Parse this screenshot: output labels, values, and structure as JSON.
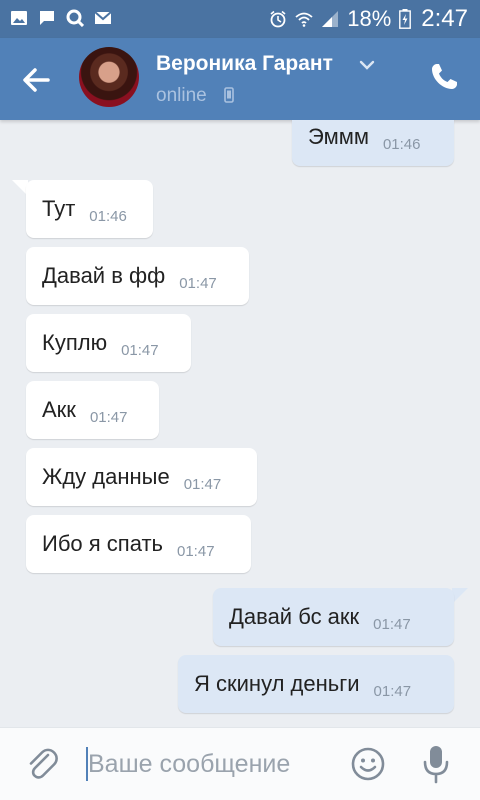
{
  "statusbar": {
    "battery": "18%",
    "time": "2:47",
    "left_icons": [
      "image-icon",
      "chat-icon",
      "search-icon",
      "gmail-icon"
    ],
    "right_icons": [
      "alarm-icon",
      "wifi-icon",
      "signal-icon",
      "battery-icon"
    ]
  },
  "header": {
    "name": "Вероника Гарант",
    "status": "online"
  },
  "messages": [
    {
      "dir": "out",
      "text": "Эммм",
      "time": "01:46"
    },
    {
      "dir": "in",
      "text": "Тут",
      "time": "01:46"
    },
    {
      "dir": "in",
      "text": "Давай в фф",
      "time": "01:47"
    },
    {
      "dir": "in",
      "text": "Куплю",
      "time": "01:47"
    },
    {
      "dir": "in",
      "text": "Акк",
      "time": "01:47"
    },
    {
      "dir": "in",
      "text": "Жду данные",
      "time": "01:47"
    },
    {
      "dir": "in",
      "text": "Ибо я спать",
      "time": "01:47"
    },
    {
      "dir": "out",
      "text": "Давай бс акк",
      "time": "01:47"
    },
    {
      "dir": "out",
      "text": "Я скинул деньги",
      "time": "01:47"
    }
  ],
  "input": {
    "placeholder": "Ваше сообщение"
  },
  "colors": {
    "header": "#5181b8",
    "background": "#ebeef2",
    "incoming": "#ffffff",
    "outgoing": "#dce7f5"
  }
}
